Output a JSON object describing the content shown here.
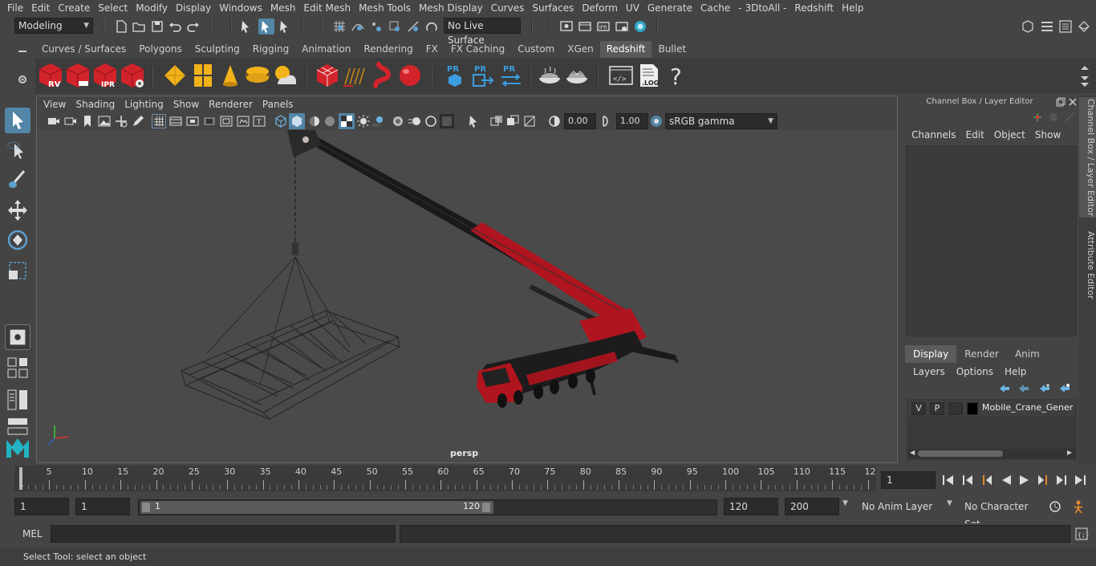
{
  "menubar": [
    "File",
    "Edit",
    "Create",
    "Select",
    "Modify",
    "Display",
    "Windows",
    "Mesh",
    "Edit Mesh",
    "Mesh Tools",
    "Mesh Display",
    "Curves",
    "Surfaces",
    "Deform",
    "UV",
    "Generate",
    "Cache",
    "- 3DtoAll -",
    "Redshift",
    "Help"
  ],
  "statusline": {
    "mode": "Modeling",
    "live_surface": "No Live Surface"
  },
  "shelf_tabs": [
    "Curves / Surfaces",
    "Polygons",
    "Sculpting",
    "Rigging",
    "Animation",
    "Rendering",
    "FX",
    "FX Caching",
    "Custom",
    "XGen",
    "Redshift",
    "Bullet"
  ],
  "shelf_active": "Redshift",
  "shelf_icon_labels": {
    "rv": "RV",
    "ipr": "IPR",
    "pr": "PR",
    "log": ".LOG",
    "help": "?"
  },
  "viewport": {
    "menu": [
      "View",
      "Shading",
      "Lighting",
      "Show",
      "Renderer",
      "Panels"
    ],
    "exposure": "0.00",
    "gamma": "1.00",
    "colorspace": "sRGB gamma",
    "camera_label": "persp"
  },
  "channelbox": {
    "title": "Channel Box / Layer Editor",
    "menu": [
      "Channels",
      "Edit",
      "Object",
      "Show"
    ],
    "layer_tabs": [
      "Display",
      "Render",
      "Anim"
    ],
    "layer_active": "Display",
    "layer_menu": [
      "Layers",
      "Options",
      "Help"
    ],
    "layer": {
      "v": "V",
      "p": "P",
      "name": "Mobile_Crane_Generic"
    }
  },
  "side_tabs": [
    "Channel Box / Layer Editor",
    "Attribute Editor"
  ],
  "timeline": {
    "labels": [
      "5",
      "10",
      "15",
      "20",
      "25",
      "30",
      "35",
      "40",
      "45",
      "50",
      "55",
      "60",
      "65",
      "70",
      "75",
      "80",
      "85",
      "90",
      "95",
      "100",
      "105",
      "110",
      "115",
      "12"
    ],
    "start_marker": "1",
    "current_frame": "1"
  },
  "range": {
    "start": "1",
    "start2": "1",
    "slider_start": "1",
    "slider_end": "120",
    "end": "120",
    "end2": "200",
    "anim_layer": "No Anim Layer",
    "char_set": "No Character Set"
  },
  "cmd": {
    "label": "MEL"
  },
  "help_text": "Select Tool: select an object",
  "colors": {
    "accent": "#5285a6",
    "crane_red": "#b0141e",
    "crane_black": "#1a1a1a"
  }
}
